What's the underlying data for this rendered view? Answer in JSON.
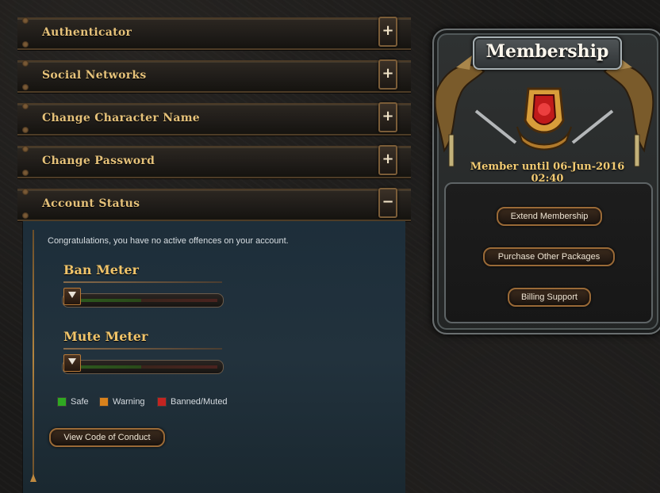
{
  "accordion": [
    {
      "label": "Authenticator",
      "toggle": "+"
    },
    {
      "label": "Social Networks",
      "toggle": "+"
    },
    {
      "label": "Change Character Name",
      "toggle": "+"
    },
    {
      "label": "Change Password",
      "toggle": "+"
    },
    {
      "label": "Account Status",
      "toggle": "−"
    }
  ],
  "account_status": {
    "message": "Congratulations, you have no active offences on your account.",
    "ban_meter": {
      "label": "Ban Meter",
      "level": 0
    },
    "mute_meter": {
      "label": "Mute Meter",
      "level": 0
    },
    "legend": [
      {
        "label": "Safe",
        "color": "#2fa822"
      },
      {
        "label": "Warning",
        "color": "#d9821c"
      },
      {
        "label": "Banned/Muted",
        "color": "#c22421"
      }
    ],
    "code_of_conduct_button": "View Code of Conduct"
  },
  "membership": {
    "title": "Membership",
    "until": "Member until 06-Jun-2016 02:40",
    "buttons": [
      "Extend Membership",
      "Purchase Other Packages",
      "Billing Support"
    ]
  },
  "colors": {
    "accent": "#e6c27a",
    "panel_blue": "#22323d"
  }
}
